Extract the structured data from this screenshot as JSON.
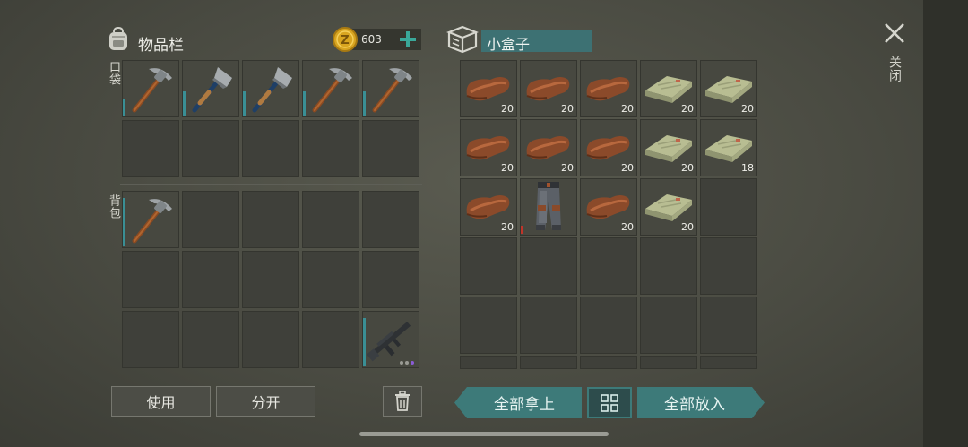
{
  "inventory": {
    "title": "物品栏",
    "coins": "603",
    "pocket_label": "口袋",
    "backpack_label": "背包",
    "pocket": [
      {
        "item": "pickaxe",
        "durability": 0.3
      },
      {
        "item": "hatchet",
        "durability": 0.45
      },
      {
        "item": "hatchet",
        "durability": 0.45
      },
      {
        "item": "pickaxe",
        "durability": 0.45
      },
      {
        "item": "pickaxe",
        "durability": 0.45
      },
      null,
      null,
      null,
      null,
      null
    ],
    "backpack": [
      {
        "item": "pickaxe",
        "durability": 0.9
      },
      null,
      null,
      null,
      null,
      null,
      null,
      null,
      null,
      null,
      null,
      null,
      null,
      null,
      {
        "item": "rifle",
        "durability": 0.9
      }
    ]
  },
  "container": {
    "title": "小盒子",
    "slots": [
      {
        "item": "leather",
        "qty": "20"
      },
      {
        "item": "leather",
        "qty": "20"
      },
      {
        "item": "leather",
        "qty": "20"
      },
      {
        "item": "cloth",
        "qty": "20"
      },
      {
        "item": "cloth",
        "qty": "20"
      },
      {
        "item": "leather",
        "qty": "20"
      },
      {
        "item": "leather",
        "qty": "20"
      },
      {
        "item": "leather",
        "qty": "20"
      },
      {
        "item": "cloth",
        "qty": "20"
      },
      {
        "item": "cloth",
        "qty": "18"
      },
      {
        "item": "leather",
        "qty": "20"
      },
      {
        "item": "pants",
        "durability": 0.15
      },
      {
        "item": "leather",
        "qty": "20"
      },
      {
        "item": "cloth",
        "qty": "20"
      },
      null,
      null,
      null,
      null,
      null,
      null,
      null,
      null,
      null,
      null,
      null,
      null,
      null,
      null,
      null,
      null
    ]
  },
  "buttons": {
    "use": "使用",
    "split": "分开",
    "take_all": "全部拿上",
    "put_all": "全部放入",
    "close": "关闭"
  },
  "colors": {
    "teal": "#3d7a79",
    "coin": "#d9a520",
    "accent_plus": "#3aa89a"
  }
}
